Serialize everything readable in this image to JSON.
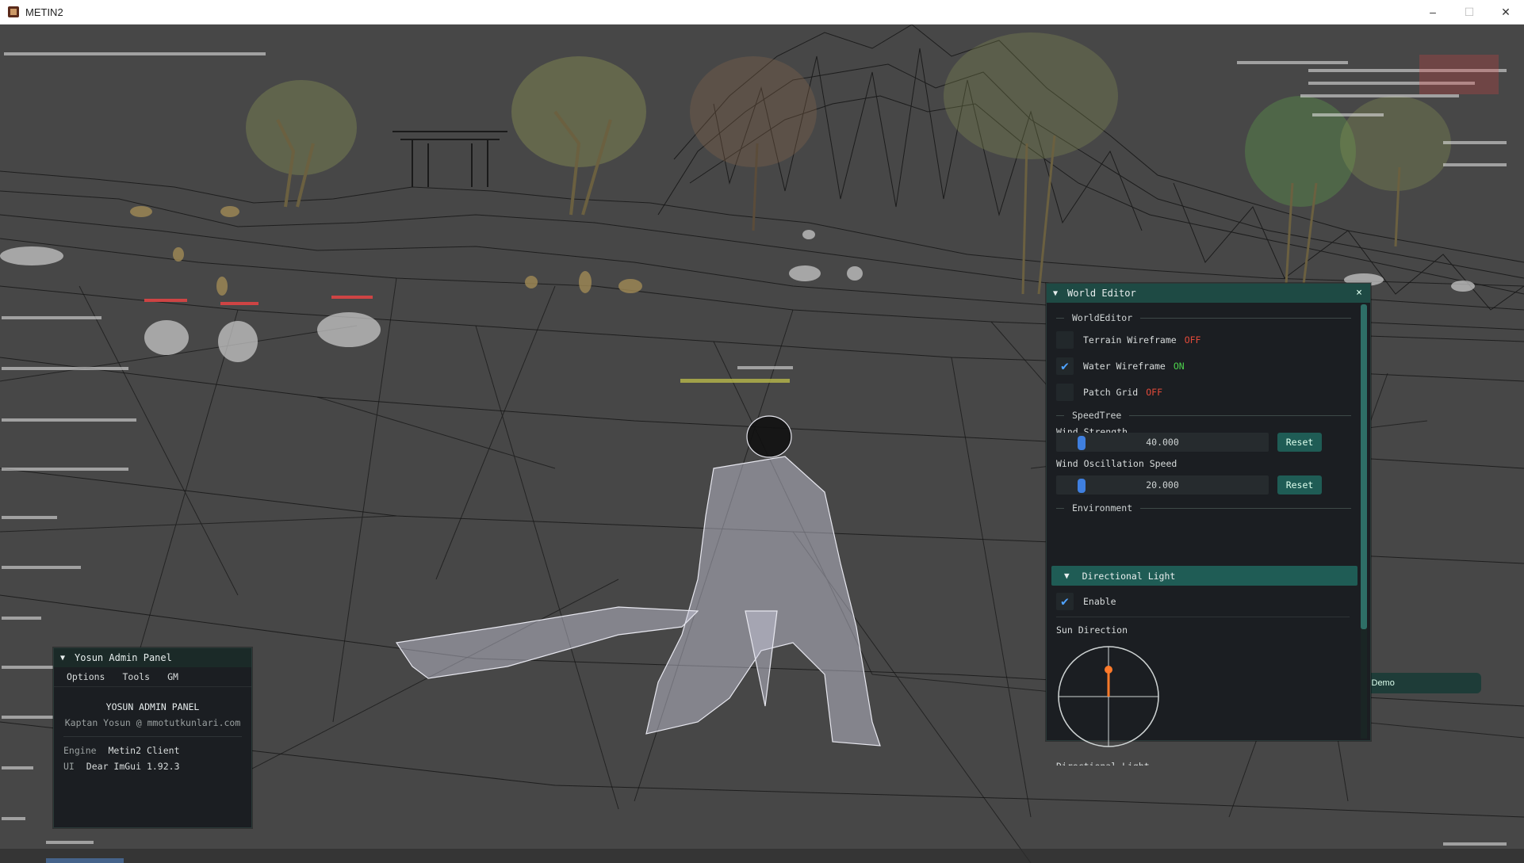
{
  "window": {
    "title": "METIN2",
    "minimize": "–",
    "maximize": "☐",
    "close": "✕"
  },
  "world_editor": {
    "title": "World Editor",
    "close": "×",
    "section_world": "WorldEditor",
    "terrain_wireframe": {
      "label": "Terrain Wireframe",
      "state": "OFF",
      "checked": false
    },
    "water_wireframe": {
      "label": "Water Wireframe",
      "state": "ON",
      "checked": true
    },
    "patch_grid": {
      "label": "Patch Grid",
      "state": "OFF",
      "checked": false
    },
    "section_speedtree": "SpeedTree",
    "wind_strength": {
      "label": "Wind Strength",
      "value": "40.000",
      "fraction": 0.1,
      "reset": "Reset"
    },
    "wind_oscillation": {
      "label": "Wind Oscillation Speed",
      "value": "20.000",
      "fraction": 0.1,
      "reset": "Reset"
    },
    "section_environment": "Environment",
    "directional_light": {
      "label": "Directional Light",
      "enable_label": "Enable",
      "enabled": true
    },
    "sun_direction_label": "Sun Direction",
    "cutoff_label": "Directional Light",
    "accent_color": "#1f5c55",
    "check_color": "#4fa3ff",
    "off_color": "#e24a3a",
    "on_color": "#4cd24c"
  },
  "admin_panel": {
    "title": "Yosun Admin Panel",
    "menu": [
      "Options",
      "Tools",
      "GM"
    ],
    "heading": "YOSUN ADMIN PANEL",
    "author": "Kaptan Yosun @ mmotutkunlari.com",
    "engine_key": "Engine",
    "engine_value": "Metin2 Client",
    "ui_key": "UI",
    "ui_value": "Dear ImGui 1.92.3"
  },
  "demo_tab": {
    "label": "i Demo"
  }
}
